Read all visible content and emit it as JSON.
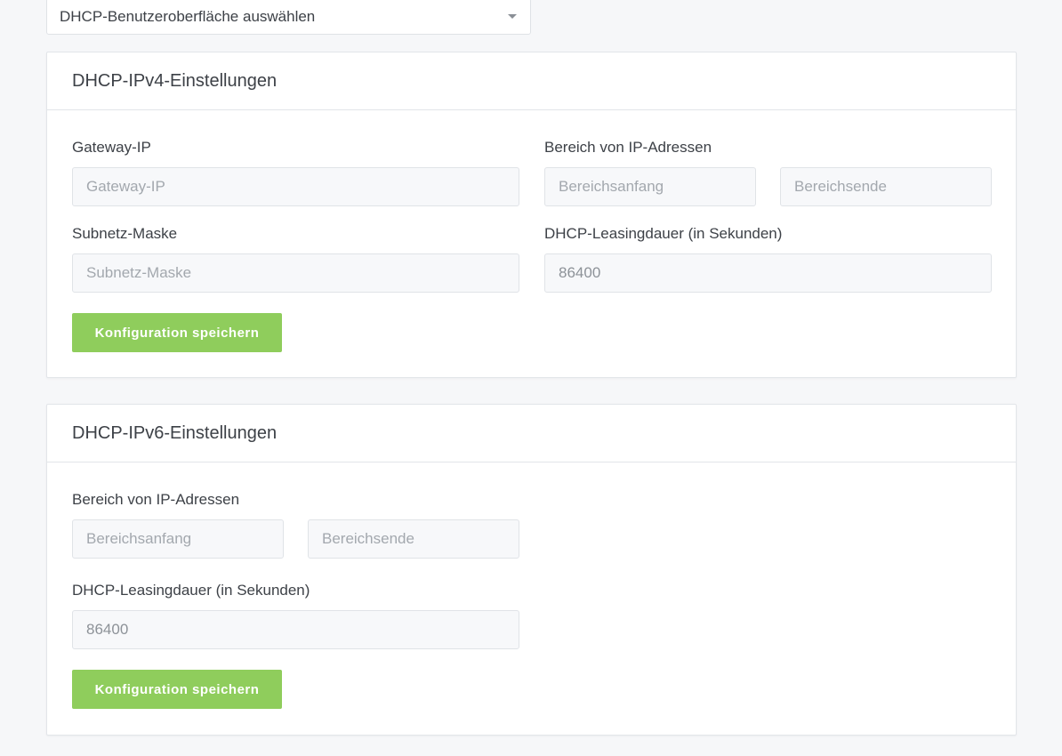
{
  "interface_select": {
    "value": "DHCP-Benutzeroberfläche auswählen"
  },
  "ipv4": {
    "title": "DHCP-IPv4-Einstellungen",
    "gateway_label": "Gateway-IP",
    "gateway_placeholder": "Gateway-IP",
    "range_label": "Bereich von IP-Adressen",
    "range_start_placeholder": "Bereichsanfang",
    "range_end_placeholder": "Bereichsende",
    "subnet_label": "Subnetz-Maske",
    "subnet_placeholder": "Subnetz-Maske",
    "lease_label": "DHCP-Leasingdauer (in Sekunden)",
    "lease_value": "86400",
    "save_label": "Konfiguration speichern"
  },
  "ipv6": {
    "title": "DHCP-IPv6-Einstellungen",
    "range_label": "Bereich von IP-Adressen",
    "range_start_placeholder": "Bereichsanfang",
    "range_end_placeholder": "Bereichsende",
    "lease_label": "DHCP-Leasingdauer (in Sekunden)",
    "lease_value": "86400",
    "save_label": "Konfiguration speichern"
  },
  "colors": {
    "accent_button": "#8fcd5c",
    "background": "#f6f7f9",
    "input_background": "#f7f8fa"
  },
  "icons": {
    "select_caret": "caret-down-icon"
  }
}
